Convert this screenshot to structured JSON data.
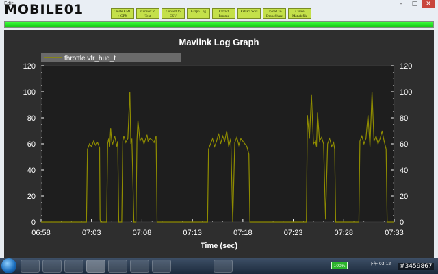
{
  "window": {
    "title": "Edit"
  },
  "logo": {
    "text": "MOBILE01"
  },
  "window_controls": {
    "minimize": "–",
    "maximize": "□",
    "close": "✕"
  },
  "toolbar": {
    "buttons": [
      {
        "line1": "Create KML",
        "line2": "+ GPX"
      },
      {
        "line1": "Convert to",
        "line2": "Text"
      },
      {
        "line1": "Convert to",
        "line2": "CSV"
      },
      {
        "line1": "Graph Log",
        "line2": ""
      },
      {
        "line1": "Extract",
        "line2": "Params"
      },
      {
        "line1": "Extract WPs",
        "line2": ""
      },
      {
        "line1": "Upload To",
        "line2": "DroneShare"
      },
      {
        "line1": "Create",
        "line2": "Matlab file"
      }
    ]
  },
  "progress": {
    "value": 1.0
  },
  "chart_data": {
    "type": "line",
    "title": "Mavlink Log Graph",
    "xlabel": "Time (sec)",
    "ylabel": "",
    "ylim": [
      0,
      120
    ],
    "yticks": [
      0,
      20,
      40,
      60,
      80,
      100,
      120
    ],
    "xtick_labels": [
      "06:58",
      "07:03",
      "07:08",
      "07:13",
      "07:18",
      "07:23",
      "07:28",
      "07:33"
    ],
    "xlim_minutes": [
      0,
      35
    ],
    "grid": false,
    "legend": "top-left",
    "series": [
      {
        "name": "throttle vfr_hud_t",
        "color": "#8f8c00",
        "x_minutes": [
          0,
          4.5,
          4.6,
          4.8,
          5.0,
          5.2,
          5.4,
          5.6,
          5.8,
          5.85,
          5.9,
          6.0,
          6.5,
          6.6,
          6.7,
          6.8,
          6.9,
          7.0,
          7.1,
          7.3,
          7.5,
          7.6,
          7.7,
          8.0,
          8.1,
          8.2,
          8.4,
          8.6,
          8.8,
          8.9,
          9.0,
          9.2,
          9.4,
          9.5,
          9.6,
          9.8,
          10.0,
          10.2,
          10.5,
          10.6,
          10.8,
          11.0,
          11.2,
          11.4,
          11.5,
          11.6,
          11.8,
          12.0,
          12.2,
          12.4,
          12.6,
          12.8,
          13.0,
          13.2,
          13.3,
          13.4,
          13.5,
          14.5,
          15.0,
          16.5,
          16.6,
          16.8,
          17.0,
          17.2,
          17.4,
          17.6,
          17.8,
          18.0,
          18.2,
          18.4,
          18.6,
          18.8,
          19.0,
          19.2,
          19.4,
          19.6,
          19.8,
          20.0,
          20.2,
          20.4,
          20.6,
          20.7,
          20.8,
          26.3,
          26.4,
          26.6,
          26.8,
          27.0,
          27.2,
          27.3,
          27.4,
          27.6,
          27.8,
          28.0,
          28.2,
          28.4,
          28.6,
          28.8,
          29.0,
          29.1,
          29.2,
          29.4,
          29.5,
          29.6,
          31.5,
          31.6,
          31.8,
          32.0,
          32.2,
          32.4,
          32.6,
          32.8,
          33.0,
          33.2,
          33.4,
          33.6,
          33.8,
          34.0,
          34.2,
          34.3,
          34.4,
          34.6,
          34.8,
          34.9,
          35.0
        ],
        "y": [
          0,
          0,
          56,
          60,
          58,
          62,
          59,
          61,
          57,
          2,
          0,
          0,
          0,
          60,
          64,
          58,
          72,
          62,
          60,
          66,
          58,
          62,
          0,
          0,
          62,
          66,
          61,
          64,
          100,
          60,
          64,
          0,
          0,
          63,
          78,
          62,
          65,
          60,
          67,
          62,
          64,
          63,
          61,
          66,
          0,
          0,
          0,
          0,
          0,
          0,
          0,
          0,
          0,
          0,
          0,
          0,
          0,
          0,
          0,
          0,
          56,
          60,
          64,
          58,
          62,
          68,
          60,
          66,
          62,
          70,
          58,
          64,
          0,
          61,
          65,
          59,
          64,
          62,
          60,
          58,
          52,
          0,
          0,
          0,
          82,
          64,
          98,
          60,
          62,
          58,
          84,
          62,
          65,
          60,
          2,
          60,
          64,
          58,
          61,
          56,
          0,
          0,
          0,
          0,
          0,
          62,
          66,
          60,
          64,
          82,
          58,
          100,
          62,
          66,
          60,
          64,
          70,
          62,
          56,
          0,
          0,
          0,
          0,
          0,
          0
        ]
      }
    ]
  },
  "taskbar": {
    "battery": "100%",
    "clock": "下午 03:12",
    "watermark": "#3459867"
  }
}
